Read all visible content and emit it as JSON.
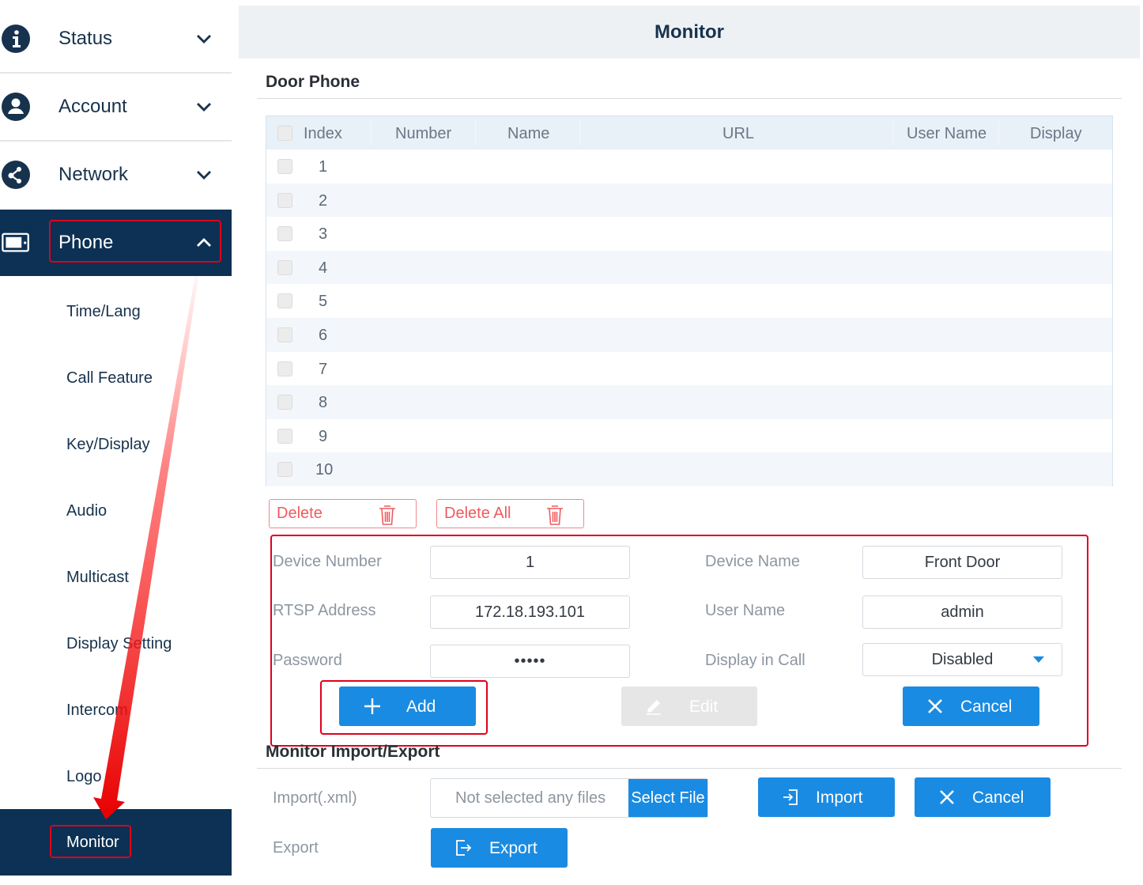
{
  "sidebar": {
    "items": [
      {
        "label": "Status",
        "icon": "info-icon"
      },
      {
        "label": "Account",
        "icon": "user-icon"
      },
      {
        "label": "Network",
        "icon": "network-icon"
      },
      {
        "label": "Phone",
        "icon": "phone-screen-icon"
      }
    ],
    "sub_items": [
      "Time/Lang",
      "Call Feature",
      "Key/Display",
      "Audio",
      "Multicast",
      "Display Setting",
      "Intercom",
      "Logo"
    ],
    "active_sub_item": "Monitor"
  },
  "header": {
    "title": "Monitor"
  },
  "door_phone": {
    "title": "Door Phone",
    "columns": [
      "Index",
      "Number",
      "Name",
      "URL",
      "User Name",
      "Display"
    ],
    "rows": [
      "1",
      "2",
      "3",
      "4",
      "5",
      "6",
      "7",
      "8",
      "9",
      "10"
    ],
    "delete_label": "Delete",
    "delete_all_label": "Delete All"
  },
  "form": {
    "device_number_label": "Device Number",
    "device_number_value": "1",
    "device_name_label": "Device Name",
    "device_name_value": "Front Door",
    "rtsp_label": "RTSP Address",
    "rtsp_value": "172.18.193.101",
    "username_label": "User Name",
    "username_value": "admin",
    "password_label": "Password",
    "password_value": "•••••",
    "display_label": "Display in Call",
    "display_value": "Disabled",
    "add_label": "Add",
    "edit_label": "Edit",
    "cancel_label": "Cancel"
  },
  "import_export": {
    "title": "Monitor Import/Export",
    "import_label": "Import(.xml)",
    "file_placeholder": "Not selected any files",
    "select_file_label": "Select File",
    "import_button": "Import",
    "cancel_button": "Cancel",
    "export_label": "Export",
    "export_button": "Export"
  },
  "colors": {
    "primary": "#1a8be2",
    "nav_active": "#0c3154",
    "highlight": "#e0001b",
    "danger": "#f05a5f"
  }
}
